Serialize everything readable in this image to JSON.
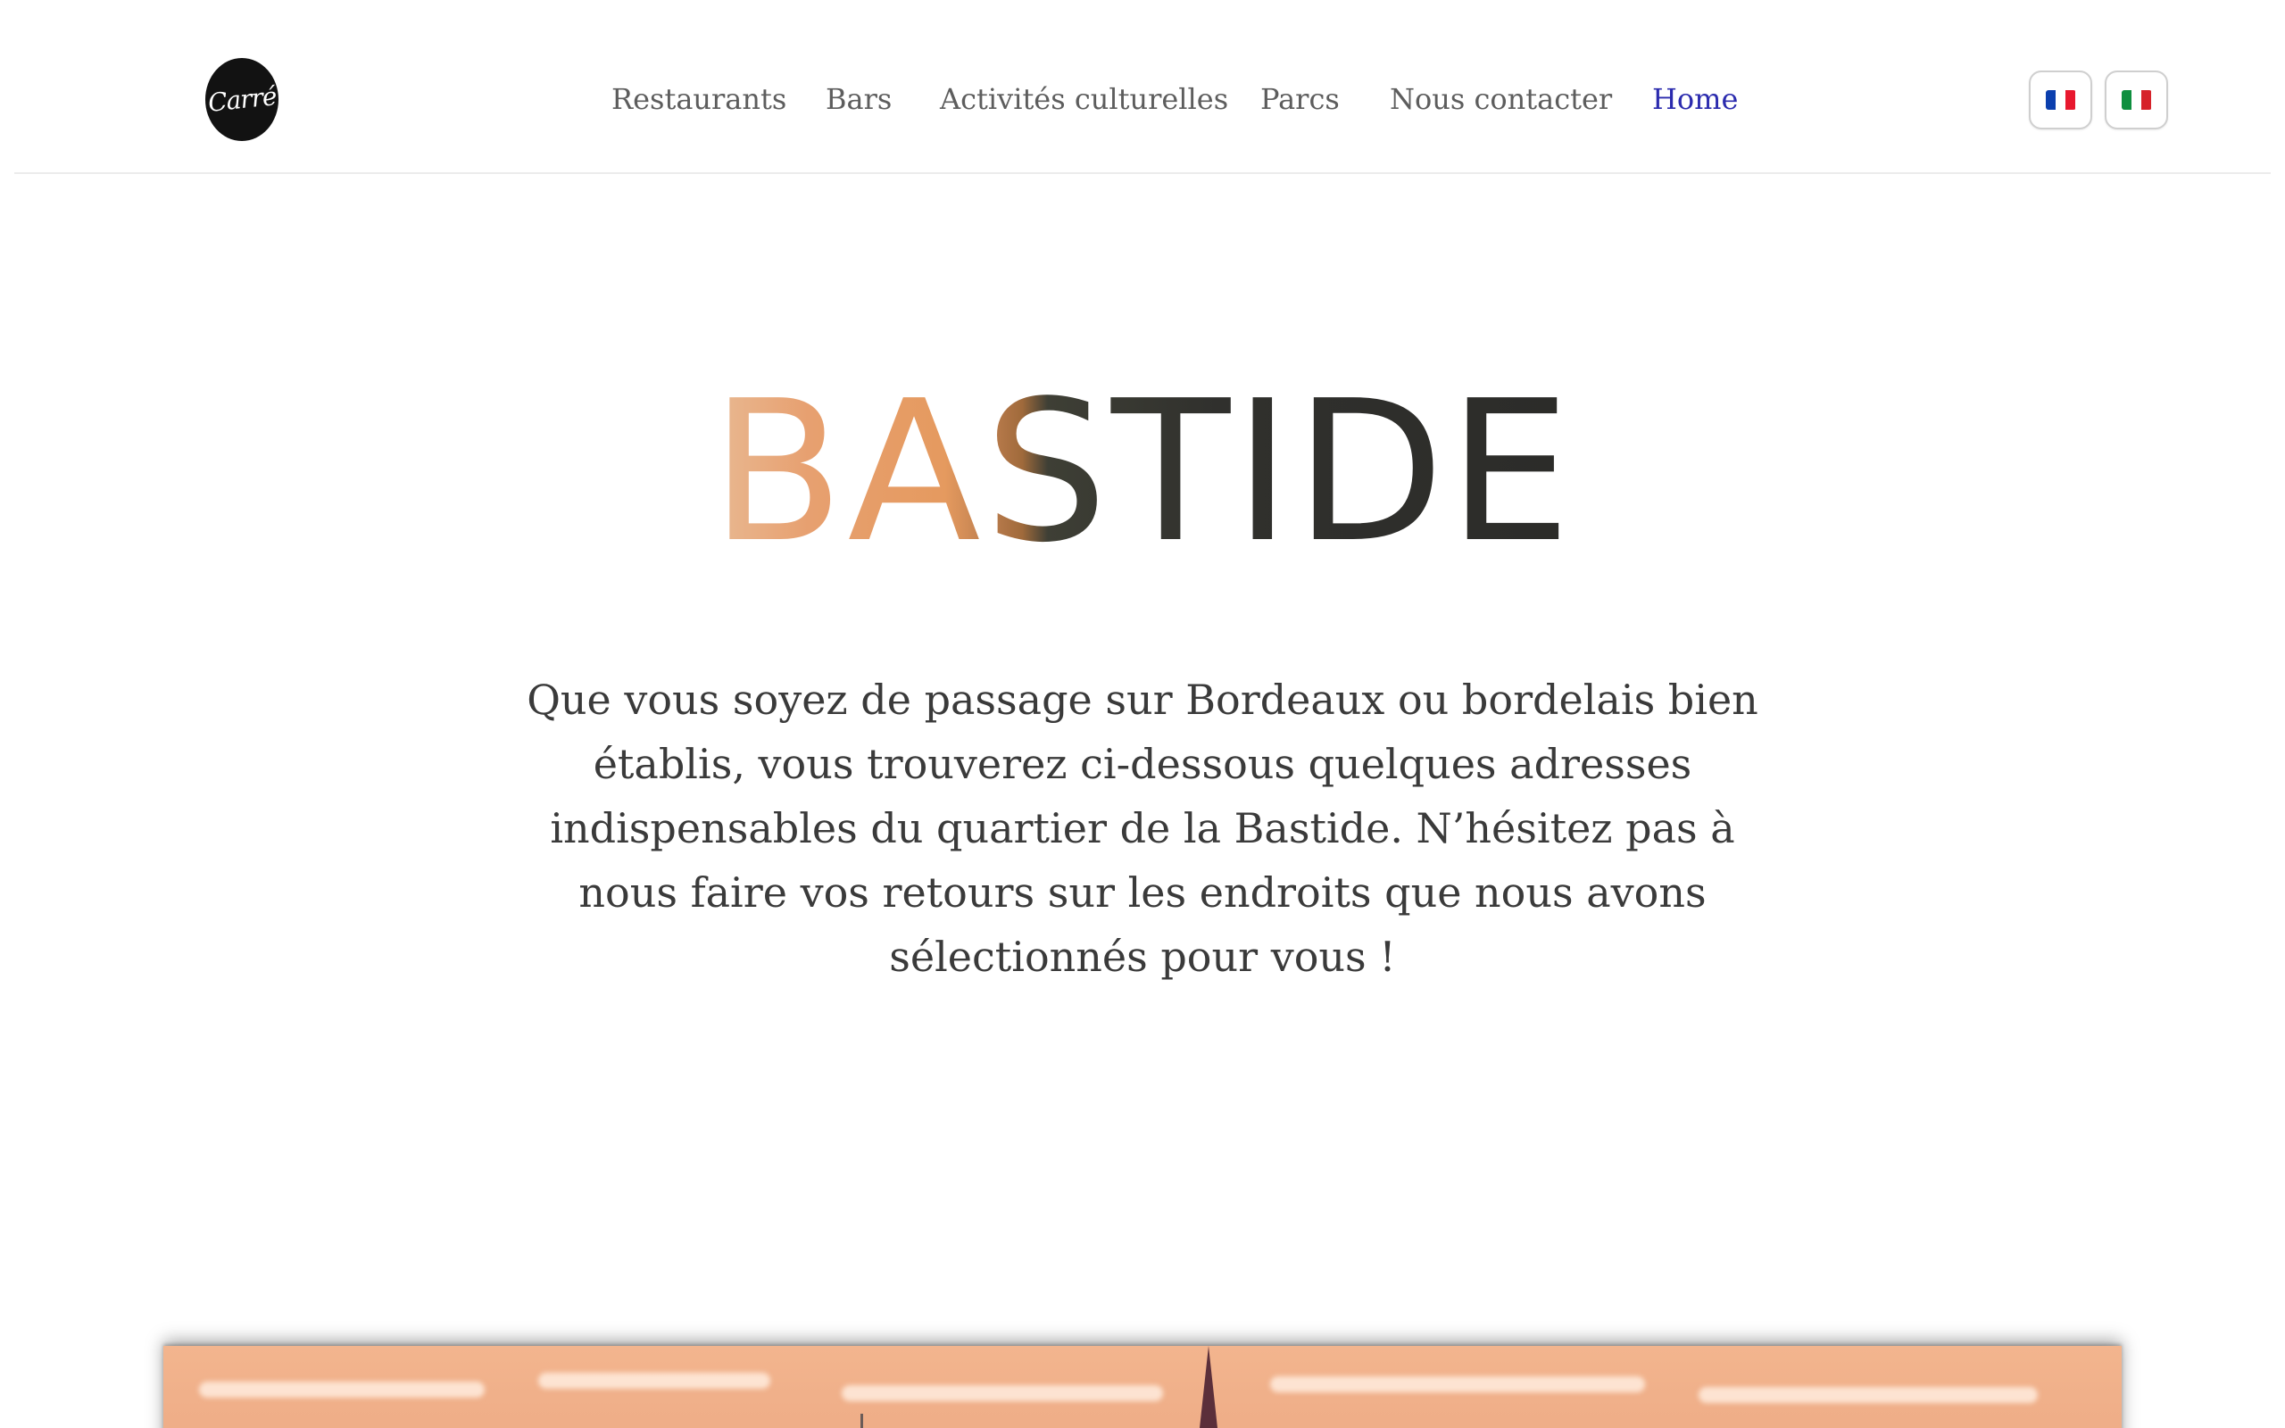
{
  "logo": {
    "text": "Carré"
  },
  "nav": {
    "items": [
      {
        "label": "Restaurants",
        "active": false
      },
      {
        "label": "Bars",
        "active": false
      },
      {
        "label": "Activités culturelles",
        "active": false
      },
      {
        "label": "Parcs",
        "active": false
      },
      {
        "label": "Nous contacter",
        "active": false
      },
      {
        "label": "Home",
        "active": true
      }
    ]
  },
  "languages": [
    {
      "code": "fr",
      "icon": "flag-france-icon",
      "colors": [
        "#0b3fae",
        "#ffffff",
        "#e8182e"
      ]
    },
    {
      "code": "it",
      "icon": "flag-italy-icon",
      "colors": [
        "#0f8f3f",
        "#ffffff",
        "#d6222a"
      ]
    }
  ],
  "hero": {
    "title": "BASTIDE",
    "intro": "Que vous soyez de passage sur Bordeaux ou bordelais bien établis, vous trouverez ci-dessous quelques adresses indispensables du quartier de la Bastide. N’hésitez pas à nous faire vos retours sur les endroits que nous avons sélectionnés pour vous !"
  },
  "colors": {
    "nav_text": "#5d5d5d",
    "nav_active": "#2b2bae",
    "body_text": "#3a3a3a",
    "logo_bg": "#121212"
  }
}
